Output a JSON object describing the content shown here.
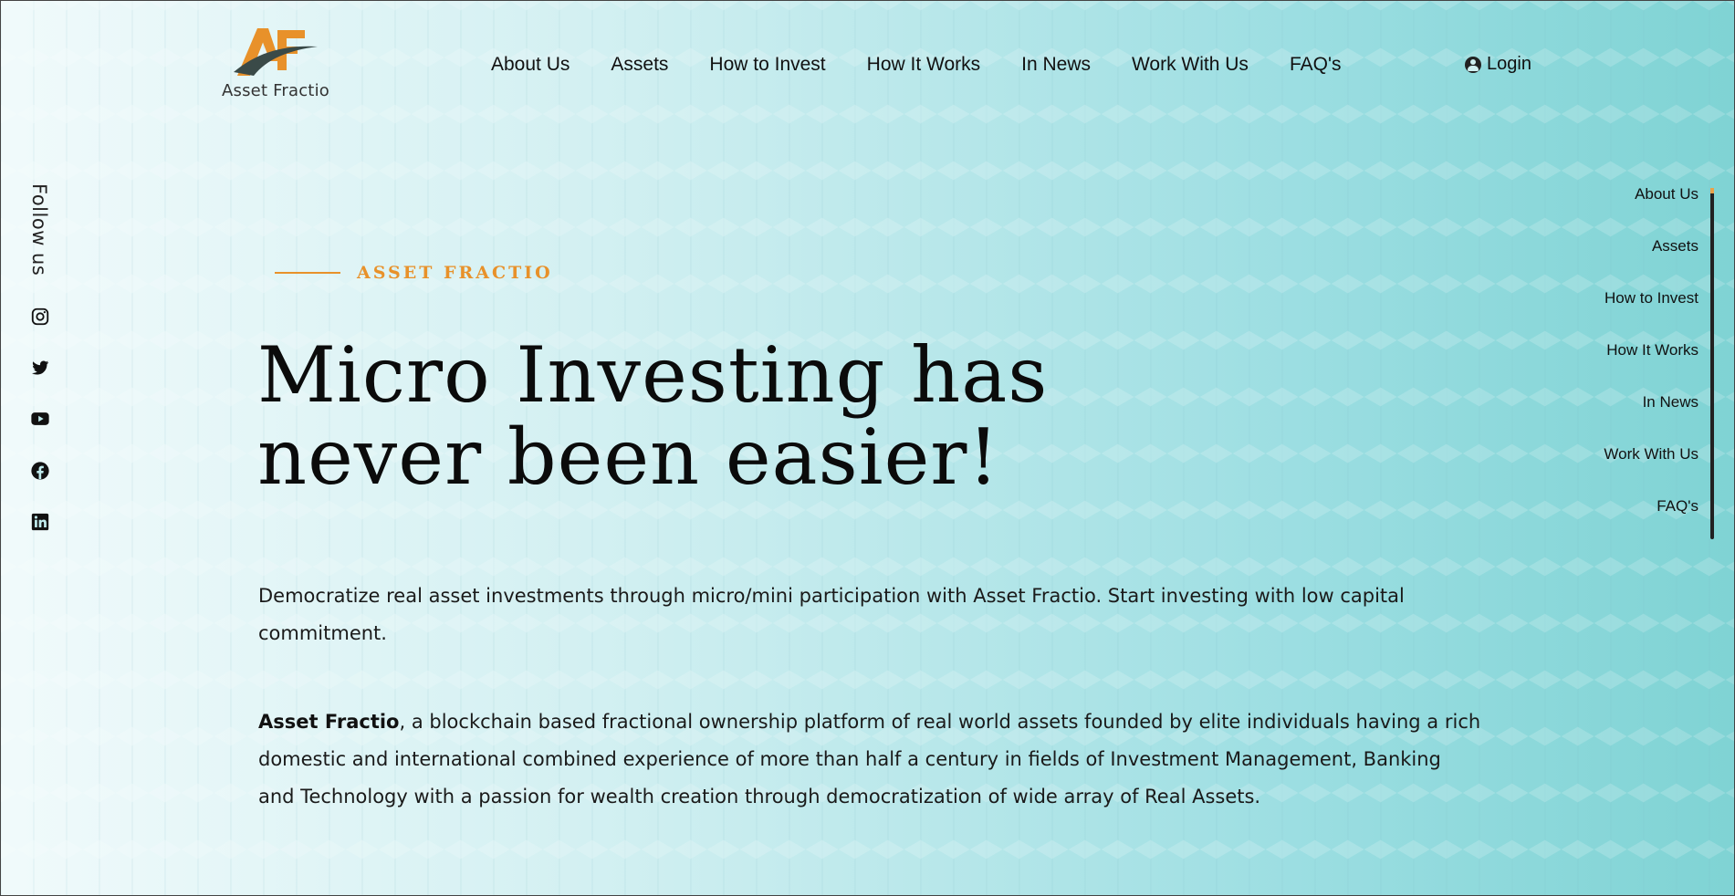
{
  "brand": {
    "name": "Asset Fractio",
    "logo_letters": "AF",
    "colors": {
      "accent_orange": "#e8912a",
      "logo_dark": "#3a4a48",
      "background_teal": "#7fd3d4"
    }
  },
  "topnav": {
    "items": [
      "About Us",
      "Assets",
      "How to Invest",
      "How It Works",
      "In News",
      "Work With Us",
      "FAQ's"
    ],
    "login_label": "Login"
  },
  "social": {
    "label": "Follow us",
    "icons": [
      "instagram-icon",
      "twitter-icon",
      "youtube-icon",
      "facebook-icon",
      "linkedin-icon"
    ]
  },
  "sidenav": {
    "items": [
      "About Us",
      "Assets",
      "How to Invest",
      "How It Works",
      "In News",
      "Work With Us",
      "FAQ's"
    ]
  },
  "hero": {
    "kicker": "ASSET FRACTIO",
    "headline_line1": "Micro Investing has",
    "headline_line2": "never been easier!",
    "paragraph1": "Democratize real asset investments through micro/mini participation with Asset Fractio. Start investing with low capital commitment.",
    "paragraph2_bold": "Asset Fractio",
    "paragraph2_rest": ", a blockchain based fractional ownership platform of real world assets founded by elite individuals having a rich domestic and international combined experience of more than half a century in fields of Investment Management, Banking and Technology with a passion for wealth creation through democratization of wide array of Real Assets."
  }
}
